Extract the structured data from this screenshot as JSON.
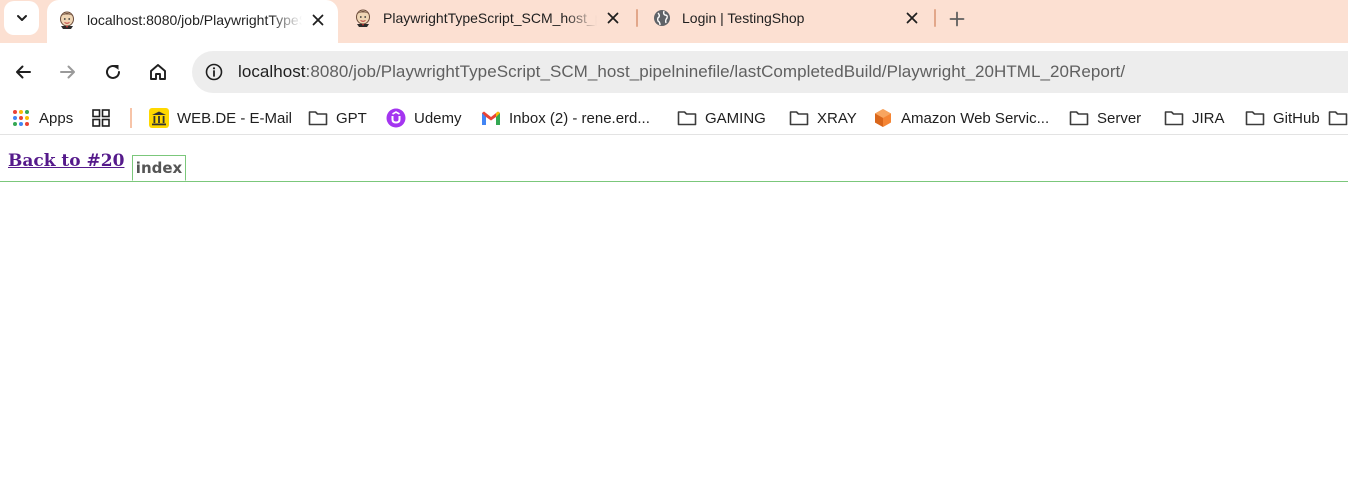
{
  "browser": {
    "tabs": [
      {
        "title": "localhost:8080/job/PlaywrightTypeScript_SCM_host_pipelninefile/lastCompletedBuild/Playwright_20HTML_20Report/",
        "icon": "jenkins-favicon",
        "active": true
      },
      {
        "title": "PlaywrightTypeScript_SCM_host_pipelninefile",
        "icon": "jenkins-favicon",
        "active": false
      },
      {
        "title": "Login | TestingShop",
        "icon": "globe-icon",
        "active": false
      }
    ],
    "address_bar": {
      "host": "localhost",
      "path": ":8080/job/PlaywrightTypeScript_SCM_host_pipelninefile/lastCompletedBuild/Playwright_20HTML_20Report/"
    },
    "bookmarks": [
      {
        "label": "Apps",
        "icon": "apps-grid-icon"
      },
      {
        "label": "",
        "icon": "tab-groups-icon"
      },
      {
        "label": "WEB.DE - E-Mail",
        "icon": "webde-icon"
      },
      {
        "label": "GPT",
        "icon": "folder-icon"
      },
      {
        "label": "Udemy",
        "icon": "udemy-icon"
      },
      {
        "label": "Inbox (2) - rene.erd...",
        "icon": "gmail-icon"
      },
      {
        "label": "GAMING",
        "icon": "folder-icon"
      },
      {
        "label": "XRAY",
        "icon": "folder-icon"
      },
      {
        "label": "Amazon Web Servic...",
        "icon": "aws-icon"
      },
      {
        "label": "Server",
        "icon": "folder-icon"
      },
      {
        "label": "JIRA",
        "icon": "folder-icon"
      },
      {
        "label": "GitHub",
        "icon": "folder-icon"
      }
    ],
    "colors": {
      "tabstrip": "#fce0d2",
      "omnibox": "#ededed",
      "link_visited": "#551a8b",
      "report_border": "#7bc77b"
    }
  },
  "page": {
    "back_link": "Back to #20",
    "report_tabs": [
      {
        "label": "index"
      }
    ]
  }
}
